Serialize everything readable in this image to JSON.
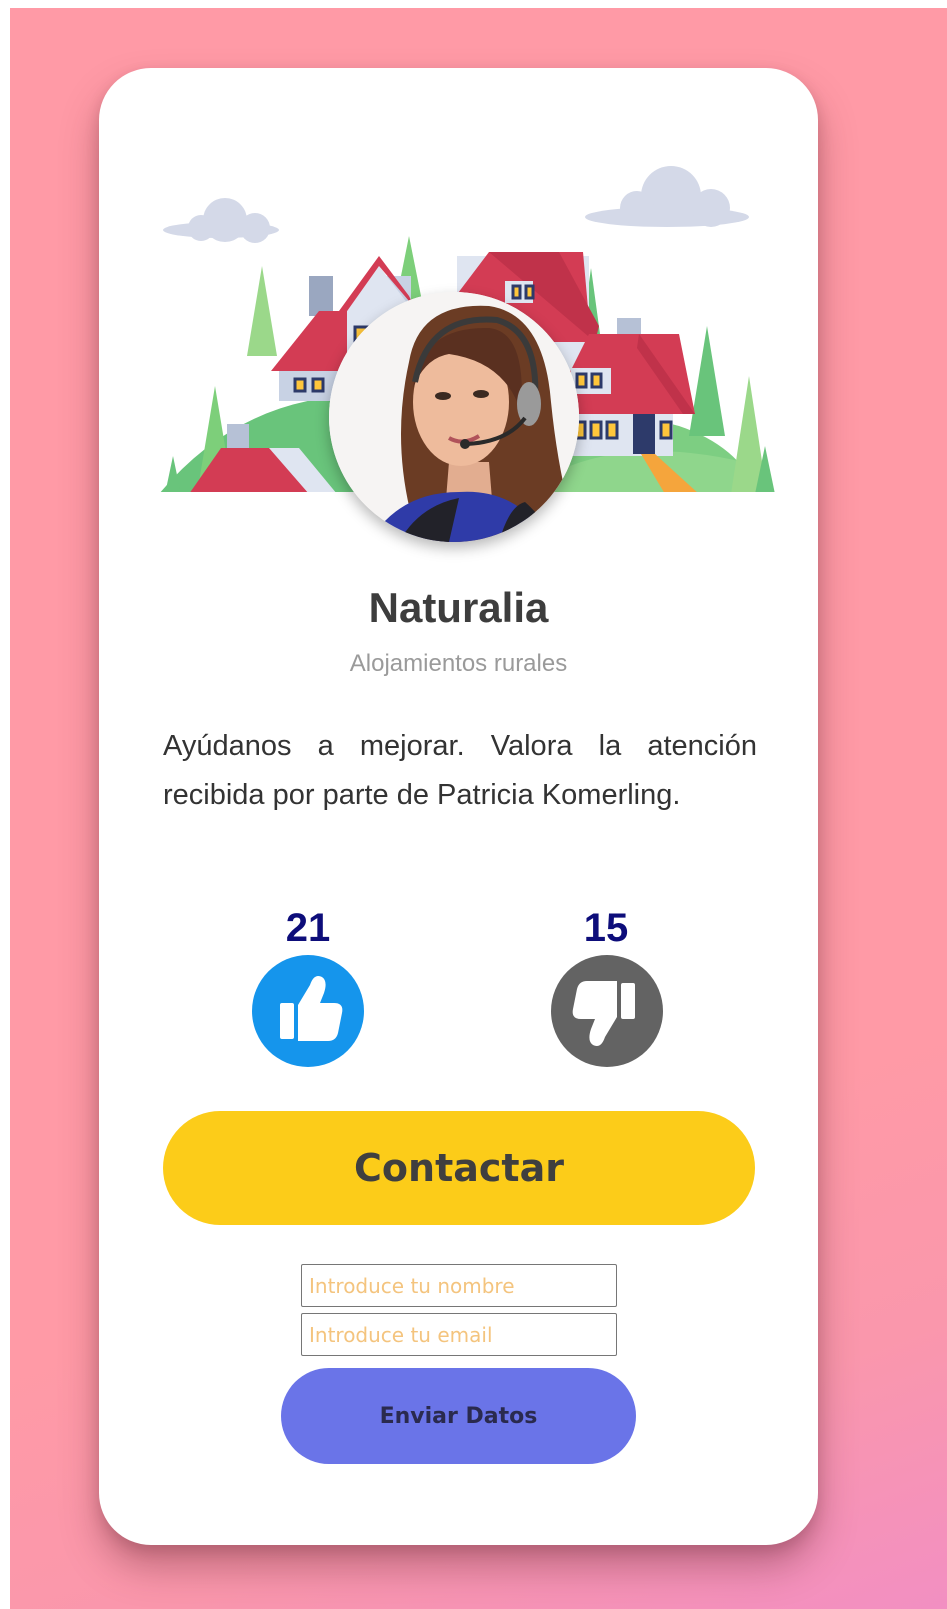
{
  "profile": {
    "company": "Naturalia",
    "tagline": "Alojamientos rurales",
    "avatar_icon": "agent-with-headset-photo"
  },
  "message": "Ayúdanos a mejorar. Valora la atención recibida por parte de Patricia Komerling.",
  "votes": {
    "likes": "21",
    "dislikes": "15",
    "like_icon": "thumbs-up-icon",
    "dislike_icon": "thumbs-down-icon"
  },
  "actions": {
    "contact_label": "Contactar"
  },
  "form": {
    "name_placeholder": "Introduce tu nombre",
    "email_placeholder": "Introduce tu email",
    "submit_label": "Enviar Datos"
  },
  "colors": {
    "background": "#ff9aa6",
    "card": "#ffffff",
    "like": "#1595ec",
    "dislike": "#636363",
    "contact_button": "#fccc19",
    "submit_button": "#6a74e8",
    "counter_text": "#0d0d7a",
    "placeholder_text": "#f4c47e"
  }
}
